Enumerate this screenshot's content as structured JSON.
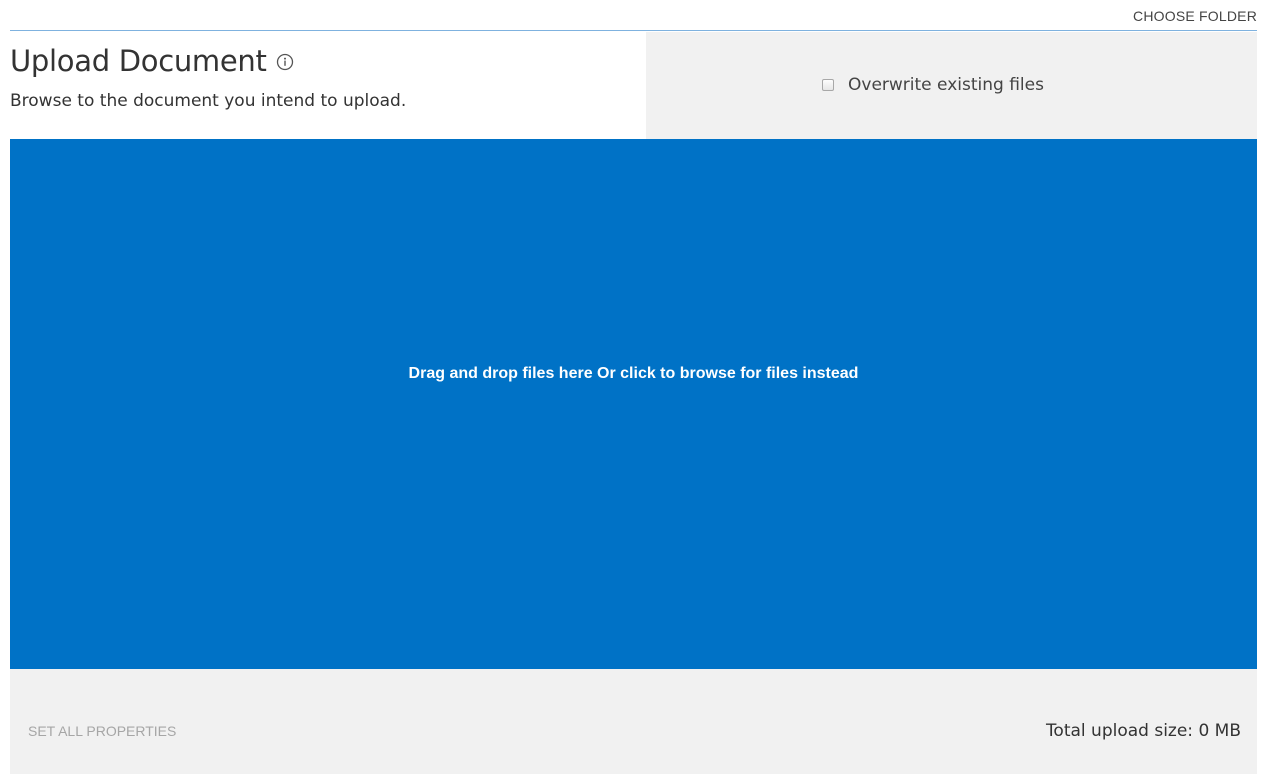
{
  "header": {
    "choose_folder_label": "CHOOSE FOLDER",
    "title": "Upload Document",
    "subtitle": "Browse to the document you intend to upload.",
    "info_icon": "info-circle-icon"
  },
  "options": {
    "overwrite_label": "Overwrite existing files",
    "overwrite_checked": false
  },
  "dropzone": {
    "text": "Drag and drop files here Or click to browse for files instead",
    "color": "#0072c6"
  },
  "footer": {
    "set_all_properties_label": "SET ALL PROPERTIES",
    "total_upload_size": "Total upload size: 0 MB"
  },
  "colors": {
    "accent": "#0072c6",
    "panel_bg": "#f1f1f1",
    "divider": "#7fb2df",
    "disabled_text": "#a6a6a6"
  }
}
